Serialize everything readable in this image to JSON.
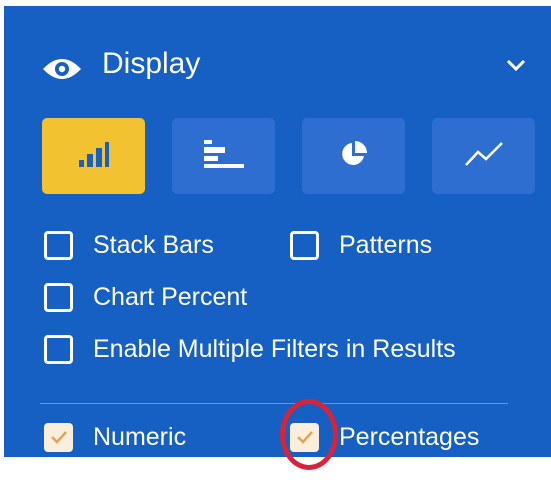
{
  "panel": {
    "title": "Display",
    "title_icon": "eye-icon",
    "collapse_icon": "chevron-down-icon",
    "background_color": "#1660c3",
    "accent_color": "#f2c230"
  },
  "chart_types": [
    {
      "icon": "vertical-bar-chart-icon",
      "active": true
    },
    {
      "icon": "horizontal-bar-chart-icon",
      "active": false
    },
    {
      "icon": "pie-chart-icon",
      "active": false
    },
    {
      "icon": "line-chart-icon",
      "active": false
    }
  ],
  "options": {
    "stack_bars": {
      "label": "Stack Bars",
      "checked": false
    },
    "patterns": {
      "label": "Patterns",
      "checked": false
    },
    "chart_percent": {
      "label": "Chart Percent",
      "checked": false
    },
    "multiple_filters": {
      "label": "Enable Multiple Filters in Results",
      "checked": false
    }
  },
  "value_options": {
    "numeric": {
      "label": "Numeric",
      "checked": true
    },
    "percentages": {
      "label": "Percentages",
      "checked": true
    }
  }
}
